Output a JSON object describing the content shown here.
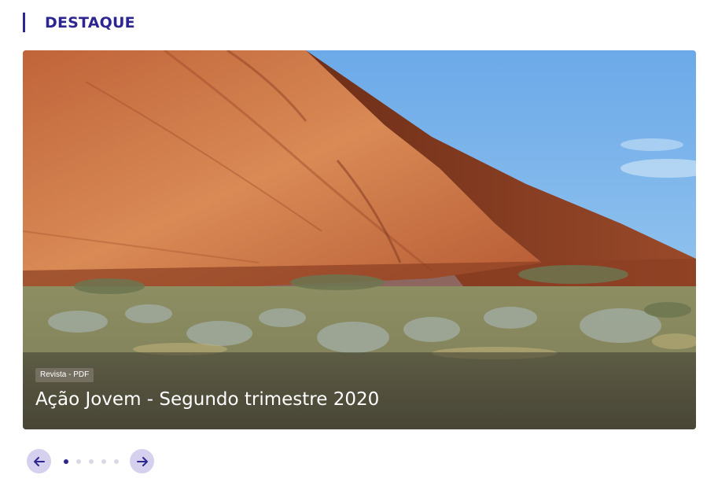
{
  "section": {
    "title": "DESTAQUE"
  },
  "carousel": {
    "slide": {
      "badge": "Revista - PDF",
      "title": "Ação Jovem - Segundo trimestre 2020"
    },
    "dots": 5,
    "active_index": 0
  },
  "colors": {
    "accent": "#2d2590",
    "nav_button_bg": "#d5d0ee",
    "dot_inactive": "#dad7e6"
  },
  "icons": {
    "prev": "arrow-left-icon",
    "next": "arrow-right-icon"
  }
}
